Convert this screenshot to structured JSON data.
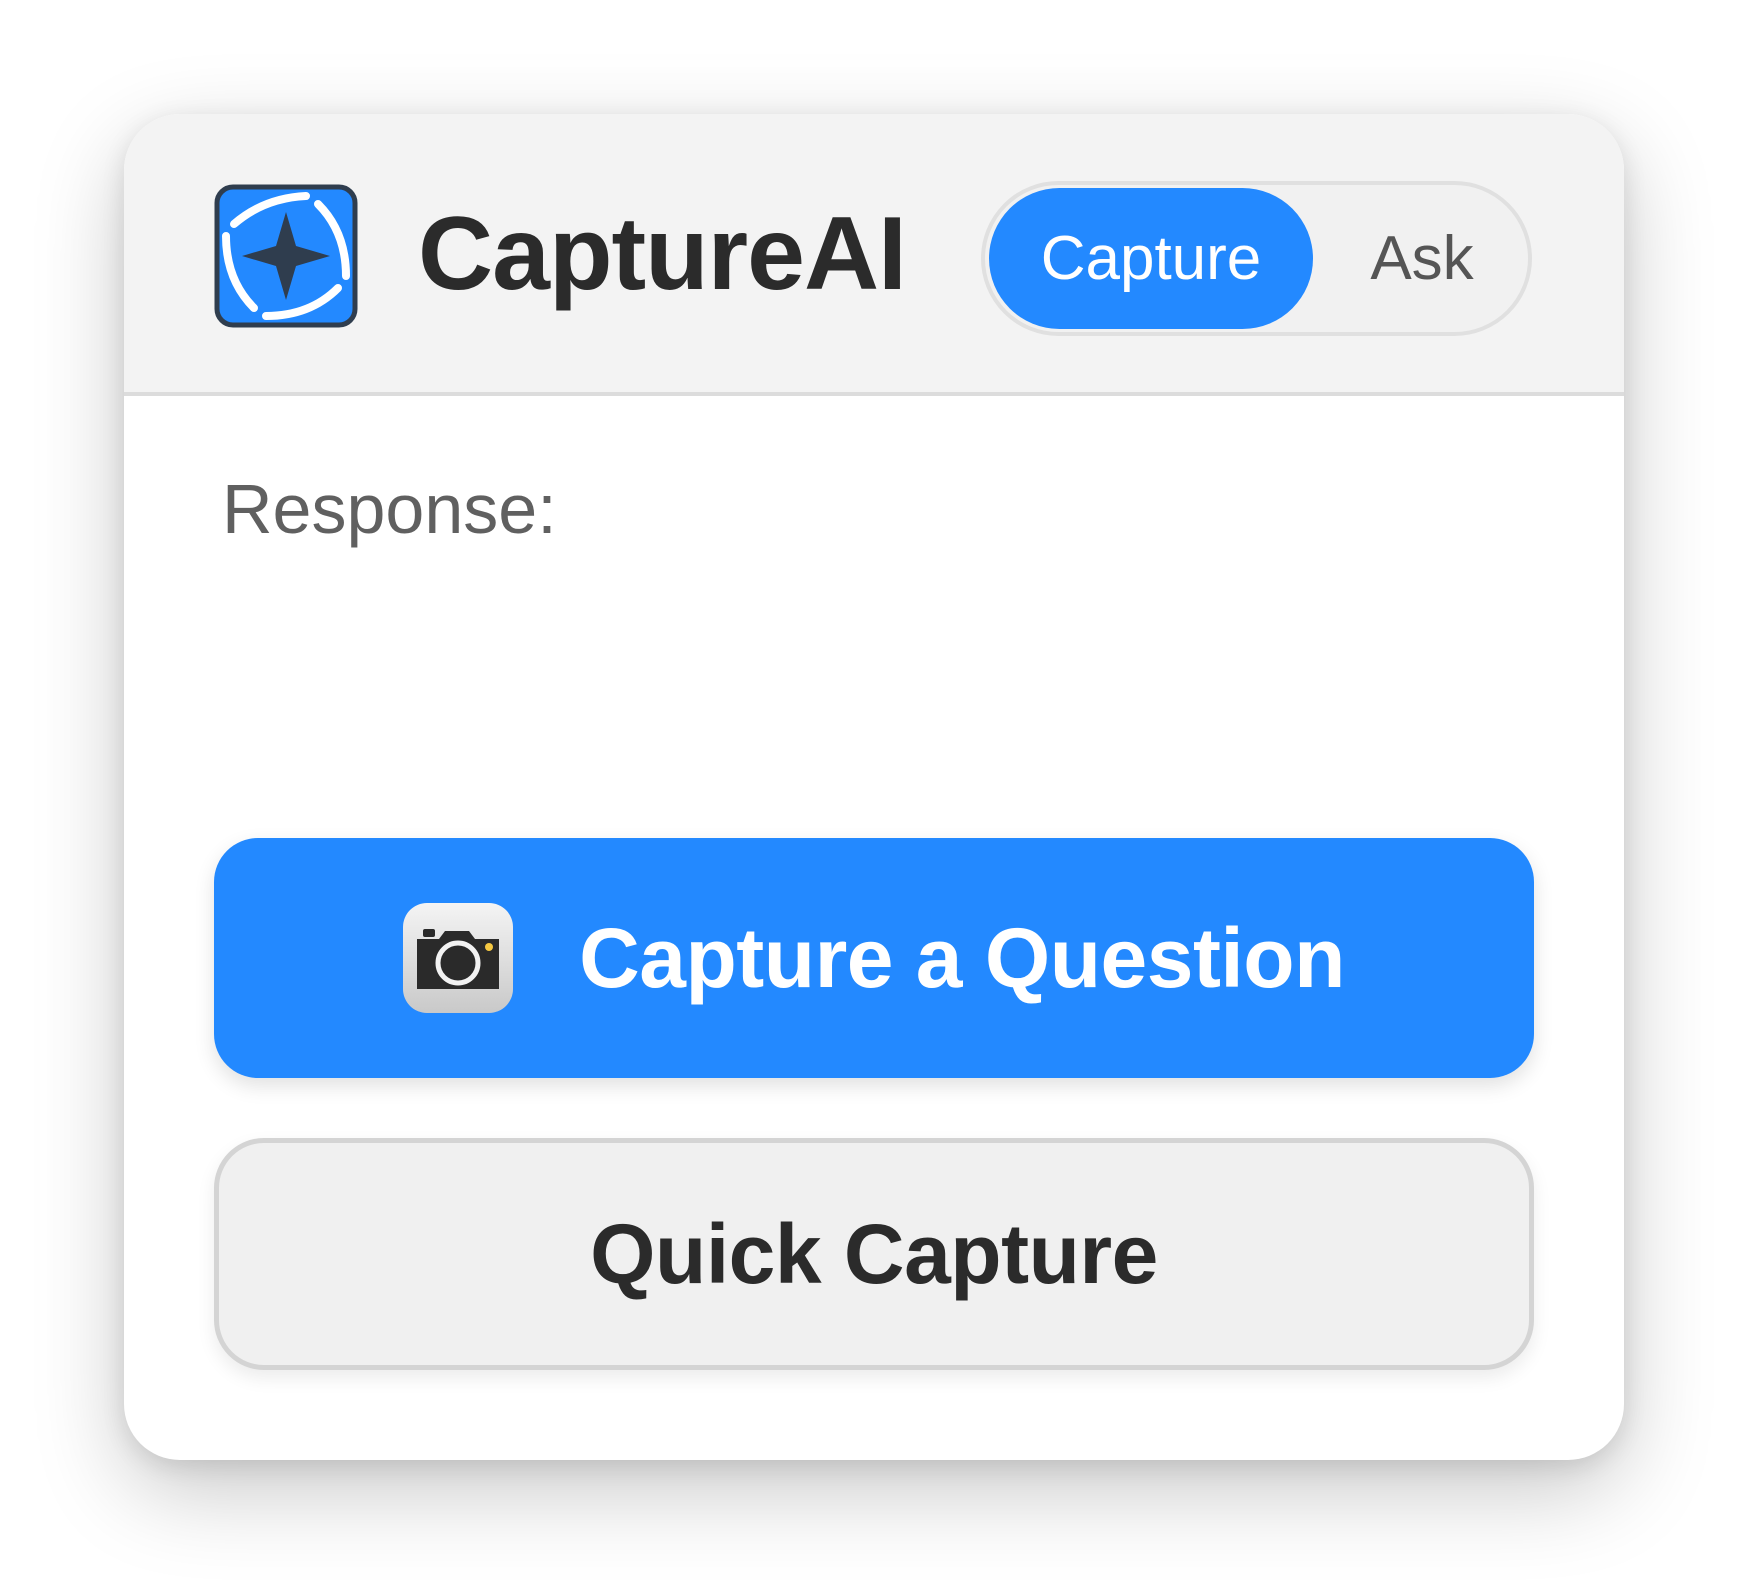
{
  "app": {
    "title": "CaptureAI",
    "logo_icon": "aperture-sparkle-icon"
  },
  "mode_toggle": {
    "options": [
      {
        "label": "Capture",
        "selected": true
      },
      {
        "label": "Ask",
        "selected": false
      }
    ]
  },
  "response": {
    "label": "Response:",
    "text": ""
  },
  "actions": {
    "primary": {
      "label": "Capture a Question",
      "icon": "camera-icon"
    },
    "secondary": {
      "label": "Quick Capture"
    }
  },
  "colors": {
    "accent": "#2389ff",
    "header_bg": "#f3f3f3",
    "title_text": "#2b2b2b",
    "logo_dark": "#2f3d4e"
  }
}
